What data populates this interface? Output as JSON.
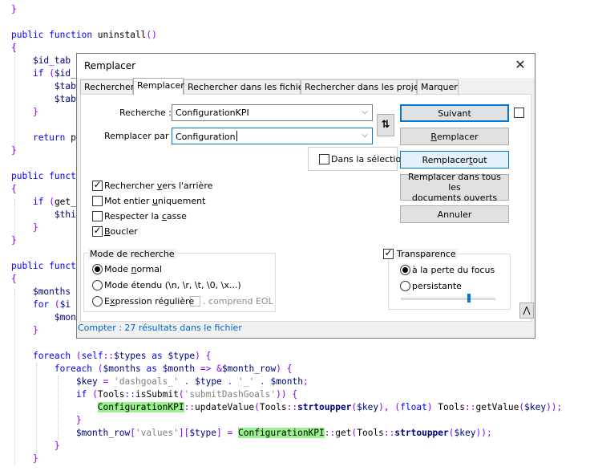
{
  "code_lines": [
    {
      "tokens": [
        [
          "}",
          "br"
        ]
      ]
    },
    {
      "tokens": []
    },
    {
      "tokens": [
        [
          "public",
          "kw"
        ],
        [
          " ",
          "id"
        ],
        [
          "function",
          "kw"
        ],
        [
          " uninstall",
          "id"
        ],
        [
          "()",
          "br"
        ]
      ]
    },
    {
      "tokens": [
        [
          "{",
          "br"
        ]
      ]
    },
    {
      "tokens": [
        [
          "    ",
          "id"
        ],
        [
          "$id_tab",
          "var"
        ]
      ]
    },
    {
      "tokens": [
        [
          "    ",
          "id"
        ],
        [
          "if",
          "kw"
        ],
        [
          " ",
          "id"
        ],
        [
          "(",
          "br"
        ],
        [
          "$id_",
          "var"
        ]
      ]
    },
    {
      "tokens": [
        [
          "        ",
          "id"
        ],
        [
          "$tab",
          "var"
        ]
      ]
    },
    {
      "tokens": [
        [
          "        ",
          "id"
        ],
        [
          "$tab",
          "var"
        ]
      ]
    },
    {
      "tokens": [
        [
          "    ",
          "id"
        ],
        [
          "}",
          "br"
        ]
      ]
    },
    {
      "tokens": []
    },
    {
      "tokens": [
        [
          "    ",
          "id"
        ],
        [
          "return",
          "kw"
        ],
        [
          " p",
          "id"
        ]
      ]
    },
    {
      "tokens": [
        [
          "}",
          "br"
        ]
      ]
    },
    {
      "tokens": []
    },
    {
      "tokens": [
        [
          "public",
          "kw"
        ],
        [
          " ",
          "id"
        ],
        [
          "funct",
          "kw"
        ]
      ]
    },
    {
      "tokens": [
        [
          "{",
          "br"
        ]
      ]
    },
    {
      "tokens": [
        [
          "    ",
          "id"
        ],
        [
          "if",
          "kw"
        ],
        [
          " ",
          "id"
        ],
        [
          "(",
          "br"
        ],
        [
          "get_",
          "id"
        ]
      ]
    },
    {
      "tokens": [
        [
          "        ",
          "id"
        ],
        [
          "$thi",
          "var"
        ]
      ]
    },
    {
      "tokens": [
        [
          "    ",
          "id"
        ],
        [
          "}",
          "br"
        ]
      ]
    },
    {
      "tokens": [
        [
          "}",
          "br"
        ]
      ]
    },
    {
      "tokens": []
    },
    {
      "tokens": [
        [
          "public",
          "kw"
        ],
        [
          " ",
          "id"
        ],
        [
          "funct",
          "kw"
        ]
      ]
    },
    {
      "tokens": [
        [
          "{",
          "br"
        ]
      ]
    },
    {
      "tokens": [
        [
          "    ",
          "id"
        ],
        [
          "$months",
          "var"
        ]
      ]
    },
    {
      "tokens": [
        [
          "    ",
          "id"
        ],
        [
          "for",
          "kw"
        ],
        [
          " ",
          "id"
        ],
        [
          "(",
          "br"
        ],
        [
          "$i",
          "var"
        ]
      ]
    },
    {
      "tokens": [
        [
          "        ",
          "id"
        ],
        [
          "$mon",
          "var"
        ]
      ]
    },
    {
      "tokens": [
        [
          "    ",
          "id"
        ],
        [
          "}",
          "br"
        ]
      ]
    },
    {
      "tokens": []
    },
    {
      "tokens": [
        [
          "    ",
          "id"
        ],
        [
          "foreach",
          "kw"
        ],
        [
          " ",
          "id"
        ],
        [
          "(",
          "br"
        ],
        [
          "self",
          "kw"
        ],
        [
          "::",
          "op"
        ],
        [
          "$types",
          "var"
        ],
        [
          " ",
          "id"
        ],
        [
          "as",
          "kw"
        ],
        [
          " ",
          "id"
        ],
        [
          "$type",
          "var"
        ],
        [
          ")",
          "br"
        ],
        [
          " ",
          "id"
        ],
        [
          "{",
          "br"
        ]
      ]
    },
    {
      "tokens": [
        [
          "        ",
          "id"
        ],
        [
          "foreach",
          "kw"
        ],
        [
          " ",
          "id"
        ],
        [
          "(",
          "br"
        ],
        [
          "$months",
          "var"
        ],
        [
          " ",
          "id"
        ],
        [
          "as",
          "kw"
        ],
        [
          " ",
          "id"
        ],
        [
          "$month",
          "var"
        ],
        [
          " ",
          "id"
        ],
        [
          "=>",
          "op"
        ],
        [
          " ",
          "id"
        ],
        [
          "&",
          "op"
        ],
        [
          "$month_row",
          "var"
        ],
        [
          ")",
          "br"
        ],
        [
          " ",
          "id"
        ],
        [
          "{",
          "br"
        ]
      ]
    },
    {
      "tokens": [
        [
          "            ",
          "id"
        ],
        [
          "$key",
          "var"
        ],
        [
          " ",
          "id"
        ],
        [
          "=",
          "op"
        ],
        [
          " ",
          "id"
        ],
        [
          "'dashgoals_'",
          "str"
        ],
        [
          " ",
          "id"
        ],
        [
          ".",
          "op"
        ],
        [
          " ",
          "id"
        ],
        [
          "$type",
          "var"
        ],
        [
          " ",
          "id"
        ],
        [
          ".",
          "op"
        ],
        [
          " ",
          "id"
        ],
        [
          "'_'",
          "str"
        ],
        [
          " ",
          "id"
        ],
        [
          ".",
          "op"
        ],
        [
          " ",
          "id"
        ],
        [
          "$month",
          "var"
        ],
        [
          ";",
          "op"
        ]
      ]
    },
    {
      "tokens": [
        [
          "            ",
          "id"
        ],
        [
          "if",
          "kw"
        ],
        [
          " ",
          "id"
        ],
        [
          "(",
          "br"
        ],
        [
          "Tools",
          "id"
        ],
        [
          "::",
          "op"
        ],
        [
          "isSubmit",
          "id"
        ],
        [
          "(",
          "br"
        ],
        [
          "'submitDashGoals'",
          "str"
        ],
        [
          "))",
          "br"
        ],
        [
          " ",
          "id"
        ],
        [
          "{",
          "br"
        ]
      ]
    },
    {
      "tokens": [
        [
          "                ",
          "id"
        ],
        [
          "ConfigurationKPI",
          "hl"
        ],
        [
          "::",
          "op"
        ],
        [
          "updateValue",
          "id"
        ],
        [
          "(",
          "br"
        ],
        [
          "Tools",
          "id"
        ],
        [
          "::",
          "op"
        ],
        [
          "strtoupper",
          "fn"
        ],
        [
          "(",
          "br"
        ],
        [
          "$key",
          "var"
        ],
        [
          ")",
          "br"
        ],
        [
          ",",
          "op"
        ],
        [
          " ",
          "id"
        ],
        [
          "(",
          "br"
        ],
        [
          "float",
          "kw"
        ],
        [
          ")",
          "br"
        ],
        [
          " Tools",
          "id"
        ],
        [
          "::",
          "op"
        ],
        [
          "getValue",
          "id"
        ],
        [
          "(",
          "br"
        ],
        [
          "$key",
          "var"
        ],
        [
          "));",
          "br"
        ]
      ]
    },
    {
      "tokens": [
        [
          "            ",
          "id"
        ],
        [
          "}",
          "br"
        ]
      ]
    },
    {
      "tokens": [
        [
          "            ",
          "id"
        ],
        [
          "$month_row",
          "var"
        ],
        [
          "[",
          "br"
        ],
        [
          "'values'",
          "str"
        ],
        [
          "][",
          "br"
        ],
        [
          "$type",
          "var"
        ],
        [
          "]",
          "br"
        ],
        [
          " ",
          "id"
        ],
        [
          "=",
          "op"
        ],
        [
          " ",
          "id"
        ],
        [
          "ConfigurationKPI",
          "hl"
        ],
        [
          "::",
          "op"
        ],
        [
          "get",
          "id"
        ],
        [
          "(",
          "br"
        ],
        [
          "Tools",
          "id"
        ],
        [
          "::",
          "op"
        ],
        [
          "strtoupper",
          "fn"
        ],
        [
          "(",
          "br"
        ],
        [
          "$key",
          "var"
        ],
        [
          "));",
          "br"
        ]
      ]
    },
    {
      "tokens": [
        [
          "        ",
          "id"
        ],
        [
          "}",
          "br"
        ]
      ]
    },
    {
      "tokens": [
        [
          "    ",
          "id"
        ],
        [
          "}",
          "br"
        ]
      ]
    }
  ],
  "dialog": {
    "title": "Remplacer",
    "close_glyph": "✕",
    "tabs": [
      {
        "label": "Rechercher"
      },
      {
        "label": "Remplacer"
      },
      {
        "label": "Rechercher dans les fichiers"
      },
      {
        "label": "Rechercher dans les projets"
      },
      {
        "label": "Marquer"
      }
    ],
    "search": {
      "label": "Recherche :",
      "value": "ConfigurationKPI"
    },
    "replace": {
      "label": "Remplacer par :",
      "value": "Configuration"
    },
    "swap_glyph": "⇅",
    "in_selection": {
      "label": "Dans la sélectio",
      "checked": false
    },
    "buttons": {
      "next": "Suivant",
      "replace_pre": "",
      "replace_u": "R",
      "replace_post": "emplacer",
      "replace_all_pre": "Remplacer ",
      "replace_all_u": "t",
      "replace_all_post": "out",
      "replace_all_docs_1": "Remplacer dans tous les",
      "replace_all_docs_2": "documents ouverts",
      "cancel": "Annuler"
    },
    "options": [
      {
        "pre": "Rechercher ",
        "u": "v",
        "post": "ers l'arrière",
        "checked": true
      },
      {
        "pre": "Mot entier ",
        "u": "u",
        "post": "niquement",
        "checked": false
      },
      {
        "pre": "Respecter la ",
        "u": "c",
        "post": "asse",
        "checked": false
      },
      {
        "pre": "",
        "u": "B",
        "post": "oucler",
        "checked": true
      }
    ],
    "search_mode": {
      "title": "Mode de recherche",
      "options": [
        {
          "pre": "Mode ",
          "u": "n",
          "post": "ormal",
          "selected": true
        },
        {
          "pre": "Mode étendu (\\n, \\r, \\t, \\0, \\x...)",
          "u": "",
          "post": "",
          "selected": false
        },
        {
          "pre": "E",
          "u": "x",
          "post": "pression régulière",
          "selected": false
        }
      ],
      "eol_label": ". comprend EOL",
      "eol_checked": false
    },
    "transparency": {
      "label": "Transparence",
      "checked": true,
      "options": [
        {
          "label": "à la perte du focus",
          "selected": true
        },
        {
          "label": "persistante",
          "selected": false
        }
      ],
      "level_percent": 72
    },
    "collapse_glyph": "⋀",
    "status": "Compter : 27 résultats dans le fichier"
  }
}
